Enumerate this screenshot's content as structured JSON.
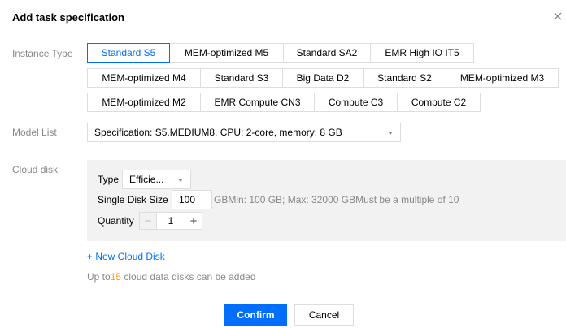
{
  "dialog": {
    "title": "Add task specification"
  },
  "instance_type": {
    "label": "Instance Type",
    "options": [
      {
        "label": "Standard S5",
        "selected": true
      },
      {
        "label": "MEM-optimized M5",
        "selected": false
      },
      {
        "label": "Standard SA2",
        "selected": false
      },
      {
        "label": "EMR High IO IT5",
        "selected": false
      },
      {
        "label": "MEM-optimized M4",
        "selected": false
      },
      {
        "label": "Standard S3",
        "selected": false
      },
      {
        "label": "Big Data D2",
        "selected": false
      },
      {
        "label": "Standard S2",
        "selected": false
      },
      {
        "label": "MEM-optimized M3",
        "selected": false
      },
      {
        "label": "MEM-optimized M2",
        "selected": false
      },
      {
        "label": "EMR Compute CN3",
        "selected": false
      },
      {
        "label": "Compute C3",
        "selected": false
      },
      {
        "label": "Compute C2",
        "selected": false
      }
    ]
  },
  "model_list": {
    "label": "Model List",
    "selected": "Specification: S5.MEDIUM8, CPU: 2-core, memory: 8 GB"
  },
  "cloud_disk": {
    "label": "Cloud disk",
    "type_label": "Type",
    "type_value": "Efficie...",
    "size_label": "Single Disk Size",
    "size_value": "100",
    "size_hint": "GBMin: 100 GB; Max: 32000 GBMust be a multiple of 10",
    "quantity_label": "Quantity",
    "quantity_value": "1",
    "decrement_symbol": "−",
    "increment_symbol": "+",
    "add_link": "+ New Cloud Disk",
    "limit_prefix": "Up to",
    "limit_count": "15",
    "limit_suffix": " cloud data disks can be added"
  },
  "footer": {
    "confirm": "Confirm",
    "cancel": "Cancel"
  },
  "colors": {
    "accent": "#006eff",
    "highlight": "#ff9c19",
    "panel": "#f2f2f2"
  }
}
